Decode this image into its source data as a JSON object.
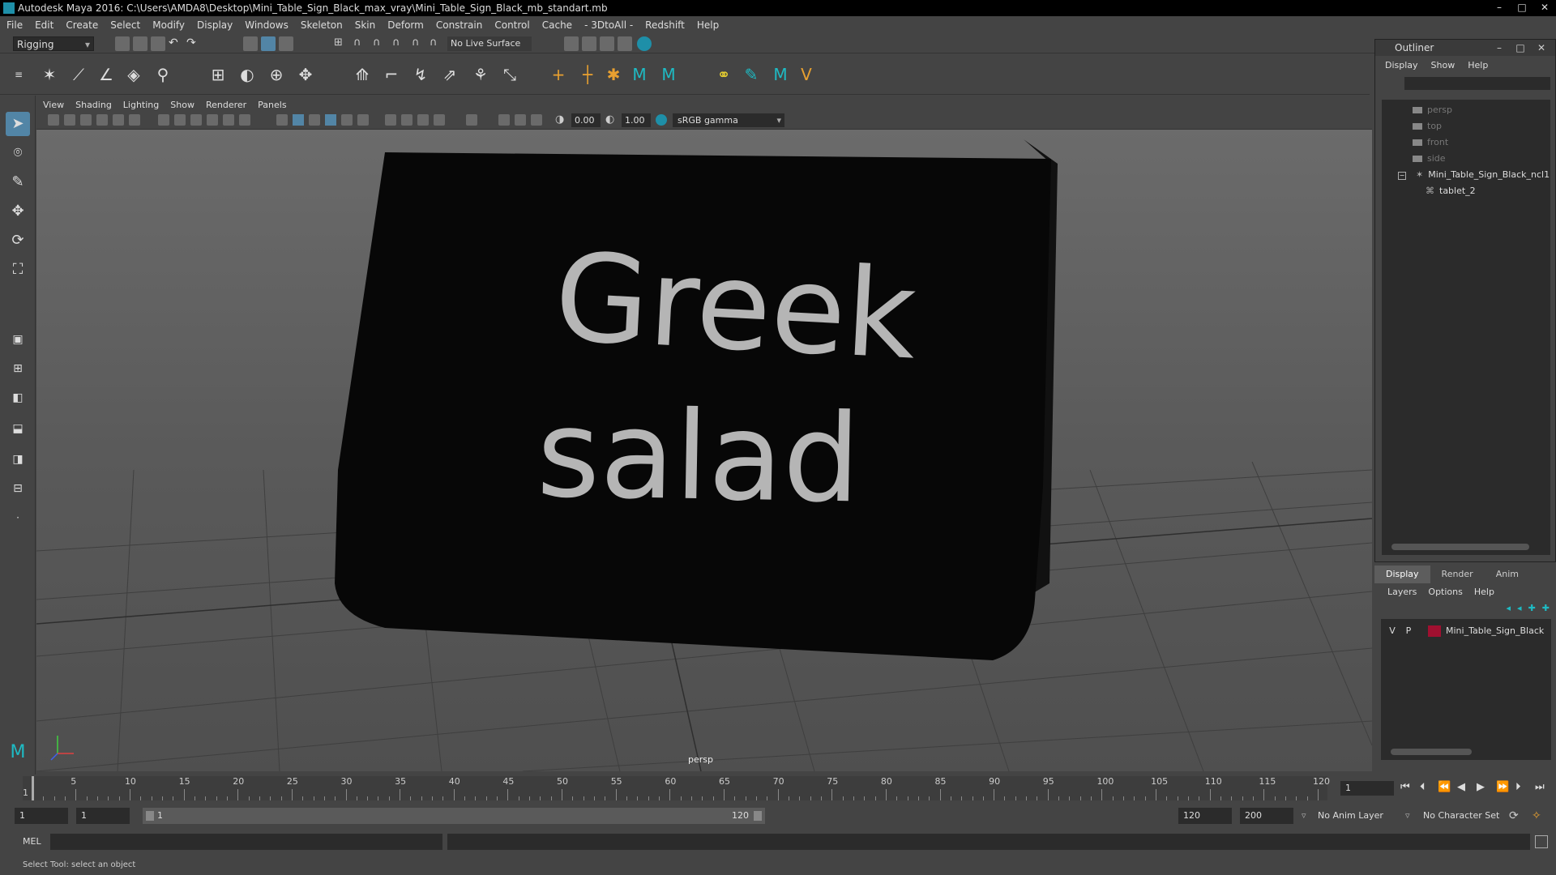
{
  "window": {
    "title": "Autodesk Maya 2016: C:\\Users\\AMDA8\\Desktop\\Mini_Table_Sign_Black_max_vray\\Mini_Table_Sign_Black_mb_standart.mb",
    "minimize": "–",
    "maximize": "□",
    "close": "✕"
  },
  "menus": [
    "File",
    "Edit",
    "Create",
    "Select",
    "Modify",
    "Display",
    "Windows",
    "Skeleton",
    "Skin",
    "Deform",
    "Constrain",
    "Control",
    "Cache",
    "- 3DtoAll -",
    "Redshift",
    "Help"
  ],
  "status": {
    "mode": "Rigging",
    "live_surface": "No Live Surface"
  },
  "viewport": {
    "menus": [
      "View",
      "Shading",
      "Lighting",
      "Show",
      "Renderer",
      "Panels"
    ],
    "exposure": "0.00",
    "gamma": "1.00",
    "color_space": "sRGB gamma",
    "camera": "persp",
    "sign_text_line1": "Greek",
    "sign_text_line2": "salad"
  },
  "outliner": {
    "title": "Outliner",
    "menus": [
      "Display",
      "Show",
      "Help"
    ],
    "items": [
      {
        "label": "persp",
        "type": "camera"
      },
      {
        "label": "top",
        "type": "camera"
      },
      {
        "label": "front",
        "type": "camera"
      },
      {
        "label": "side",
        "type": "camera"
      },
      {
        "label": "Mini_Table_Sign_Black_ncl1",
        "type": "group"
      },
      {
        "label": "tablet_2",
        "type": "mesh"
      }
    ]
  },
  "layers": {
    "tabs": [
      "Display",
      "Render",
      "Anim"
    ],
    "active_tab": "Display",
    "menus": [
      "Layers",
      "Options",
      "Help"
    ],
    "rows": [
      {
        "v": "V",
        "p": "P",
        "name": "Mini_Table_Sign_Black",
        "color": "#a01030"
      }
    ]
  },
  "timeline": {
    "ticks": [
      "5",
      "10",
      "15",
      "20",
      "25",
      "30",
      "35",
      "40",
      "45",
      "50",
      "55",
      "60",
      "65",
      "70",
      "75",
      "80",
      "85",
      "90",
      "95",
      "100",
      "105",
      "110",
      "115",
      "120"
    ],
    "start_tick_label": "1",
    "current_frame": "1"
  },
  "range": {
    "start": "1",
    "playback_start": "1",
    "bar_start": "1",
    "bar_end": "120",
    "playback_end": "120",
    "end": "200",
    "anim_layer": "No Anim Layer",
    "character_set": "No Character Set"
  },
  "command": {
    "lang": "MEL"
  },
  "help_line": "Select Tool: select an object",
  "colors": {
    "active_tool": "#5285a6",
    "layer_color": "#a01030",
    "maya_blue": "#1e8fa8"
  }
}
